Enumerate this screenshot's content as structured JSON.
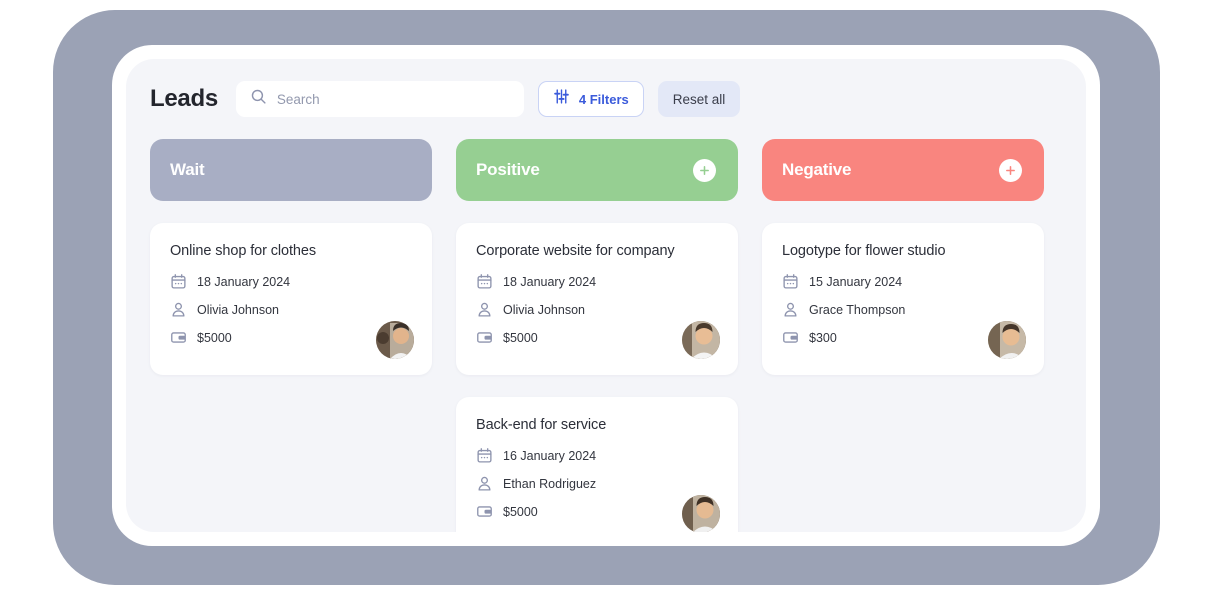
{
  "header": {
    "title": "Leads",
    "search": {
      "placeholder": "Search",
      "value": "",
      "icon": "search-icon"
    },
    "filters_button": {
      "label": "4 Filters",
      "icon": "sliders-icon",
      "count": 4
    },
    "reset_button": {
      "label": "Reset all"
    }
  },
  "colors": {
    "page_background": "#f4f5f9",
    "device_frame": "#ffffff",
    "outer_frame": "#9ba2b5",
    "wait": "#a8aec4",
    "positive": "#96cf92",
    "negative": "#f9857f",
    "accent_blue": "#3b5bdb",
    "reset_background": "#e3e8f7",
    "icon_gray_blue": "#8e94ae"
  },
  "board": {
    "columns": [
      {
        "id": "wait",
        "title": "Wait",
        "color": "#a8aec4",
        "has_add_button": false,
        "add_label": "",
        "cards": [
          {
            "title": "Online shop for clothes",
            "date": "18 January 2024",
            "person": "Olivia Johnson",
            "amount": "$5000",
            "date_icon": "calendar-icon",
            "person_icon": "user-icon",
            "amount_icon": "wallet-icon",
            "avatar": "avatar-photo"
          }
        ]
      },
      {
        "id": "positive",
        "title": "Positive",
        "color": "#96cf92",
        "has_add_button": true,
        "add_label": "+",
        "cards": [
          {
            "title": "Corporate website for company",
            "date": "18 January 2024",
            "person": "Olivia Johnson",
            "amount": "$5000",
            "date_icon": "calendar-icon",
            "person_icon": "user-icon",
            "amount_icon": "wallet-icon",
            "avatar": "avatar-photo"
          },
          {
            "title": "Back-end for service",
            "date": "16 January 2024",
            "person": "Ethan Rodriguez",
            "amount": "$5000",
            "date_icon": "calendar-icon",
            "person_icon": "user-icon",
            "amount_icon": "wallet-icon",
            "avatar": "avatar-photo"
          }
        ]
      },
      {
        "id": "negative",
        "title": "Negative",
        "color": "#f9857f",
        "has_add_button": true,
        "add_label": "+",
        "cards": [
          {
            "title": "Logotype for flower studio",
            "date": "15 January 2024",
            "person": "Grace Thompson",
            "amount": "$300",
            "date_icon": "calendar-icon",
            "person_icon": "user-icon",
            "amount_icon": "wallet-icon",
            "avatar": "avatar-photo"
          }
        ]
      }
    ]
  }
}
